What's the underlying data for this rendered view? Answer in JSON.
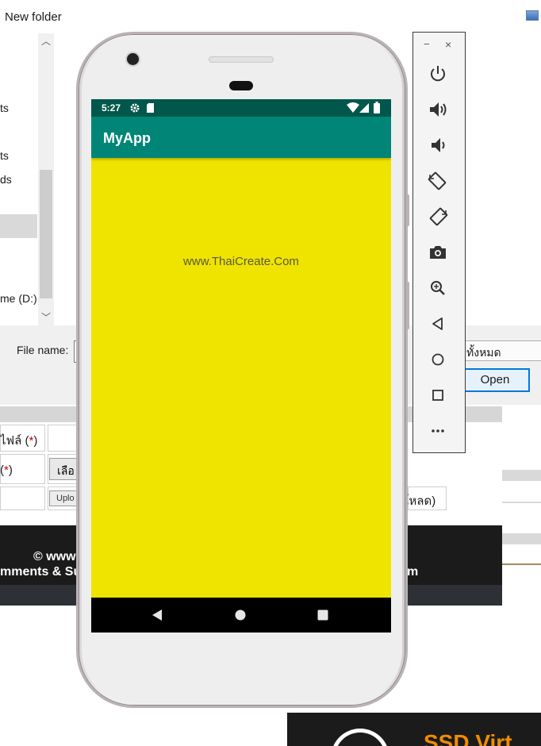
{
  "dialog": {
    "title": "New folder",
    "nav_items": [
      "ts",
      "ts",
      "ds",
      "me (D:)"
    ],
    "file_name_label": "File name:",
    "filter_label": "ทั้งหมด",
    "open_button": "Open"
  },
  "webpage": {
    "row1_label": "ไฟล์ (",
    "row2_label": "(",
    "required_mark": "*",
    "close_paren": ")",
    "choose_button": "เลือ",
    "upload_button": "Uplo",
    "download_fragment": "งโหลด)",
    "footer_line1": "© www",
    "footer_line2_left": "mments & Su",
    "footer_line2_right": "m"
  },
  "ad": {
    "text": "SSD Virt"
  },
  "phone": {
    "status_time": "5:27",
    "app_title": "MyApp",
    "content_text": "www.ThaiCreate.Com",
    "screen_bg": "#efe300",
    "appbar_color": "#008577",
    "statusbar_color": "#00574b"
  },
  "emulator_toolbar": {
    "minimize": "−",
    "close": "×",
    "buttons": [
      "power-icon",
      "volume-up-icon",
      "volume-down-icon",
      "rotate-left-icon",
      "rotate-right-icon",
      "camera-icon",
      "zoom-icon",
      "back-icon",
      "home-icon",
      "overview-icon",
      "more-icon"
    ]
  }
}
